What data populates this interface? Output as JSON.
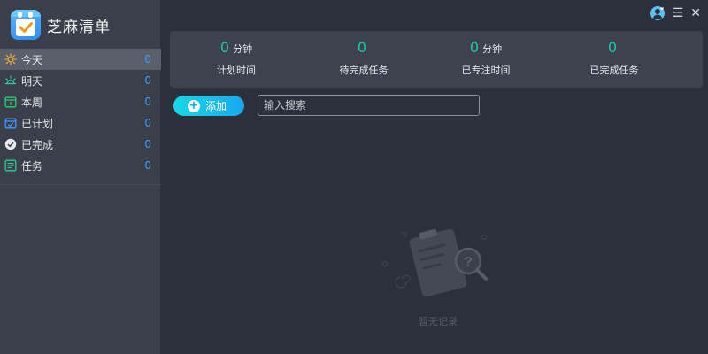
{
  "app": {
    "title": "芝麻清单"
  },
  "sidebar": {
    "items": [
      {
        "label": "今天",
        "count": "0",
        "icon": "sun-icon"
      },
      {
        "label": "明天",
        "count": "0",
        "icon": "sunrise-icon"
      },
      {
        "label": "本周",
        "count": "0",
        "icon": "calendar-week-icon"
      },
      {
        "label": "已计划",
        "count": "0",
        "icon": "calendar-check-icon"
      },
      {
        "label": "已完成",
        "count": "0",
        "icon": "check-circle-icon"
      },
      {
        "label": "任务",
        "count": "0",
        "icon": "task-list-icon"
      }
    ]
  },
  "stats": [
    {
      "value": "0",
      "unit": "分钟",
      "label": "计划时间"
    },
    {
      "value": "0",
      "unit": "",
      "label": "待完成任务"
    },
    {
      "value": "0",
      "unit": "分钟",
      "label": "已专注时间"
    },
    {
      "value": "0",
      "unit": "",
      "label": "已完成任务"
    }
  ],
  "toolbar": {
    "add_label": "添加",
    "search_placeholder": "输入搜索"
  },
  "empty": {
    "text": "暂无记录"
  },
  "window": {
    "menu_glyph": "☰",
    "close_glyph": "✕"
  },
  "colors": {
    "accent": "#3d9bff",
    "stat_value": "#22c4a6",
    "add_button": "#19a7f0"
  }
}
